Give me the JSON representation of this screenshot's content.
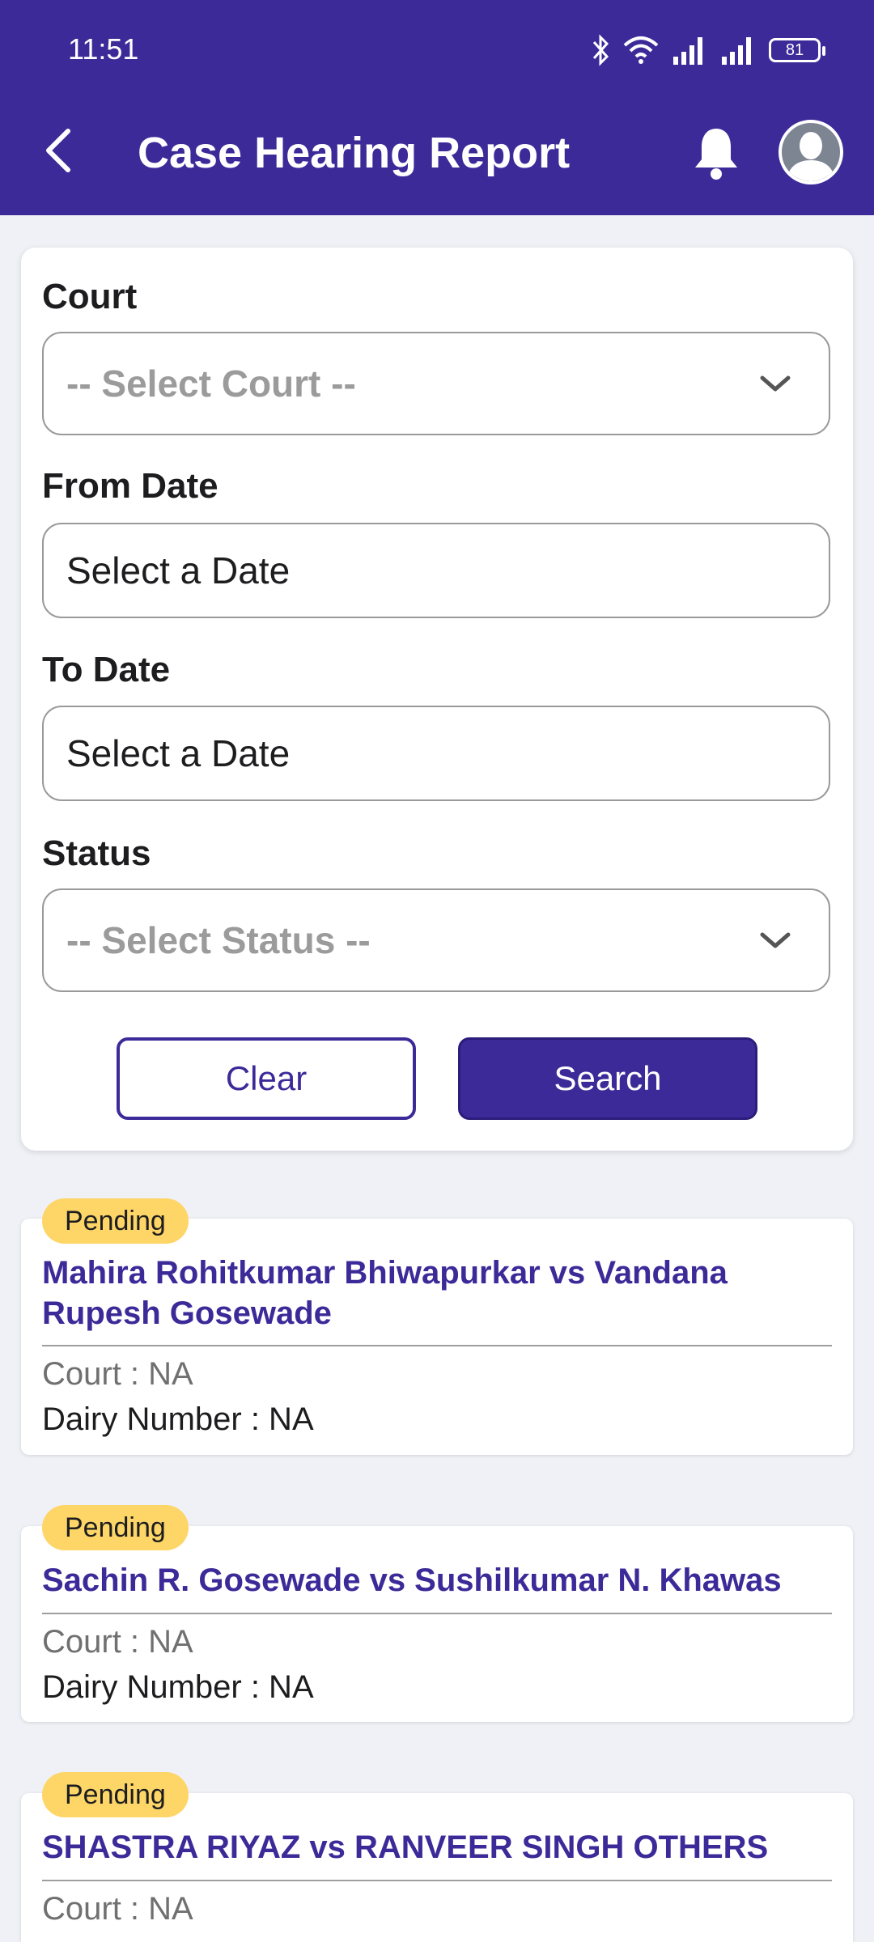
{
  "status_bar": {
    "time": "11:51",
    "battery": "81"
  },
  "header": {
    "title": "Case Hearing Report"
  },
  "filters": {
    "court": {
      "label": "Court",
      "placeholder": "-- Select Court --"
    },
    "from_date": {
      "label": "From Date",
      "value": "Select a Date"
    },
    "to_date": {
      "label": "To Date",
      "value": "Select a Date"
    },
    "status": {
      "label": "Status",
      "placeholder": "-- Select Status --"
    },
    "clear_label": "Clear",
    "search_label": "Search"
  },
  "cases": [
    {
      "badge": "Pending",
      "title": "Mahira Rohitkumar Bhiwapurkar vs Vandana Rupesh Gosewade",
      "court": "Court : NA",
      "dairy": "Dairy Number : NA"
    },
    {
      "badge": "Pending",
      "title": "Sachin R. Gosewade vs Sushilkumar N. Khawas",
      "court": "Court : NA",
      "dairy": "Dairy Number : NA"
    },
    {
      "badge": "Pending",
      "title": "SHASTRA RIYAZ vs RANVEER SINGH OTHERS",
      "court": "Court : NA"
    }
  ],
  "colors": {
    "primary": "#3d2a99",
    "badge": "#fdd667",
    "background": "#eff1f6"
  }
}
